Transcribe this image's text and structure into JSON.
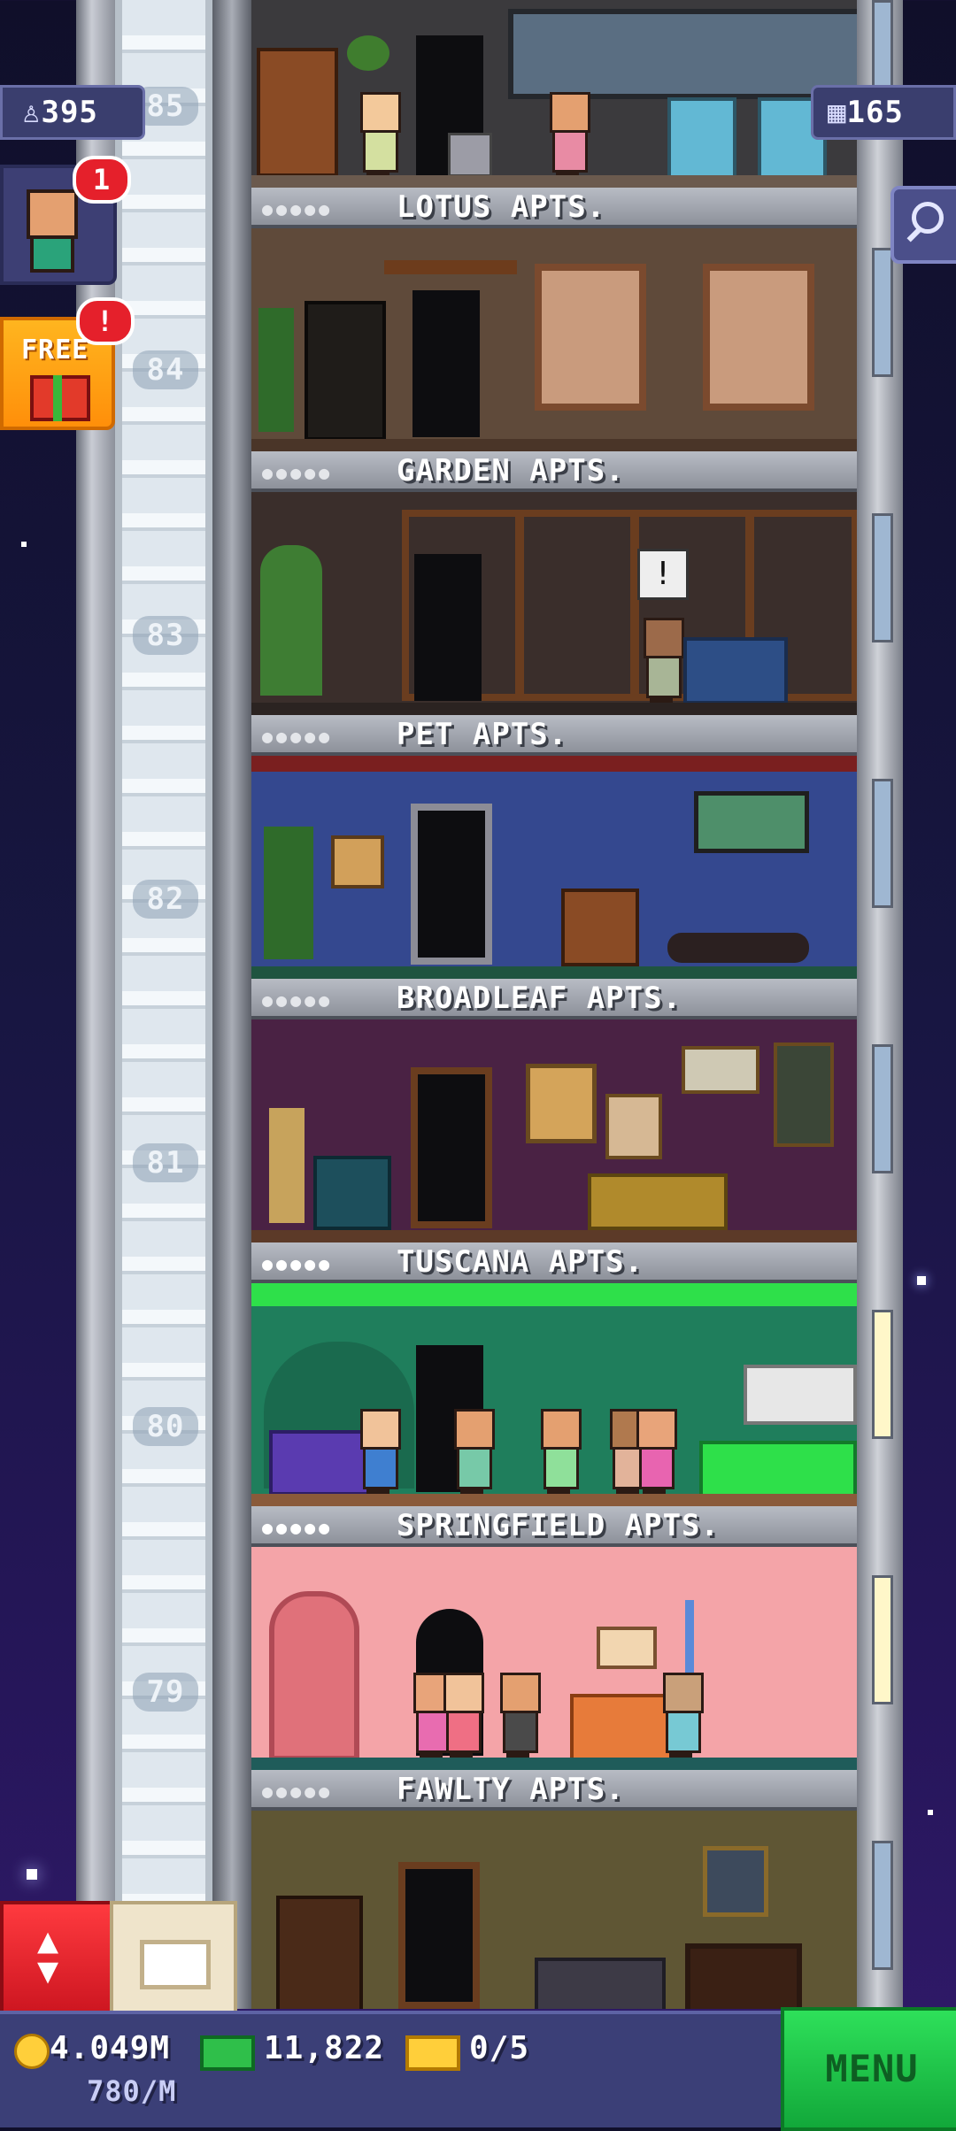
{
  "hud": {
    "population": "395",
    "floor_count": "165",
    "visitor_notif": "1",
    "free_label": "FREE",
    "free_notif": "!",
    "coins": "4.049M",
    "coin_rate": "780/M",
    "bux": "11,822",
    "tickets": "0/5",
    "menu_label": "MENU"
  },
  "floor_numbers": [
    "85",
    "84",
    "83",
    "82",
    "81",
    "80",
    "79"
  ],
  "floors": [
    {
      "name": "LOTUS APTS."
    },
    {
      "name": "GARDEN APTS."
    },
    {
      "name": "PET APTS."
    },
    {
      "name": "BROADLEAF APTS."
    },
    {
      "name": "TUSCANA APTS."
    },
    {
      "name": "SPRINGFIELD APTS."
    },
    {
      "name": "FAWLTY APTS."
    }
  ],
  "label_dots": "●●●●●",
  "colors": {
    "notif": "#e5202b",
    "menu": "#2ee05a",
    "elevator_button": "#ff3a3f",
    "free_button": "#ffb51f"
  },
  "icons": [
    "person-icon",
    "building-icon",
    "search-icon",
    "gift-icon",
    "elevator-arrows-icon",
    "lobby-icon",
    "coin-icon",
    "bux-icon",
    "ticket-icon"
  ]
}
